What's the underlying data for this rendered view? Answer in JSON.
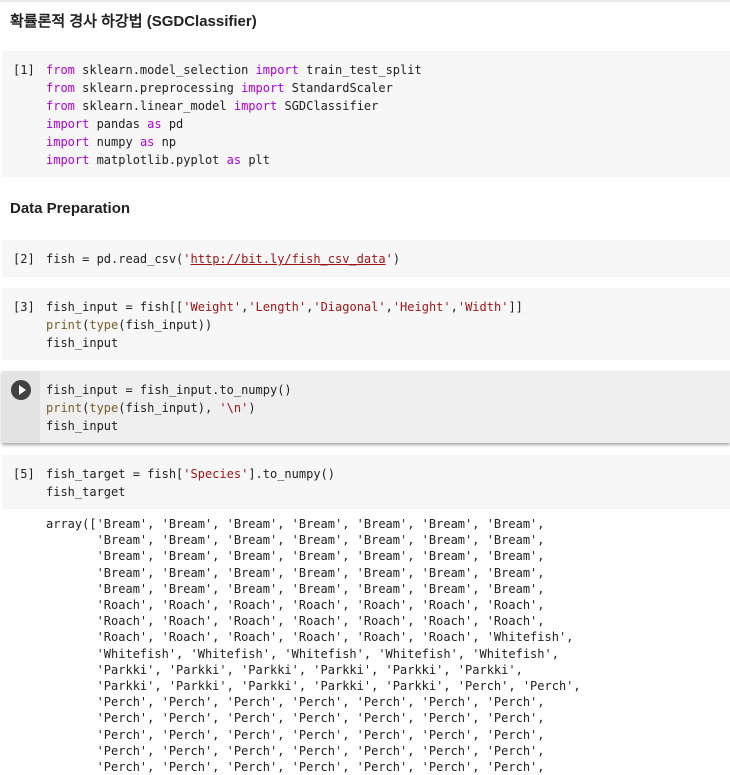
{
  "headings": {
    "title": "확률론적 경사 하강법 (SGDClassifier)",
    "data_prep": "Data Preparation"
  },
  "cells": [
    {
      "prompt": "[1]",
      "lines": [
        [
          {
            "t": "from",
            "c": "kw"
          },
          {
            "t": " sklearn.model_selection "
          },
          {
            "t": "import",
            "c": "kw"
          },
          {
            "t": " train_test_split"
          }
        ],
        [
          {
            "t": "from",
            "c": "kw"
          },
          {
            "t": " sklearn.preprocessing "
          },
          {
            "t": "import",
            "c": "kw"
          },
          {
            "t": " StandardScaler"
          }
        ],
        [
          {
            "t": "from",
            "c": "kw"
          },
          {
            "t": " sklearn.linear_model "
          },
          {
            "t": "import",
            "c": "kw"
          },
          {
            "t": " SGDClassifier"
          }
        ],
        [
          {
            "t": "import",
            "c": "kw"
          },
          {
            "t": " pandas "
          },
          {
            "t": "as",
            "c": "kw"
          },
          {
            "t": " pd"
          }
        ],
        [
          {
            "t": "import",
            "c": "kw"
          },
          {
            "t": " numpy "
          },
          {
            "t": "as",
            "c": "kw"
          },
          {
            "t": " np"
          }
        ],
        [
          {
            "t": "import",
            "c": "kw"
          },
          {
            "t": " matplotlib.pyplot "
          },
          {
            "t": "as",
            "c": "kw"
          },
          {
            "t": " plt"
          }
        ]
      ]
    },
    {
      "prompt": "[2]",
      "lines": [
        [
          {
            "t": "fish = pd.read_csv("
          },
          {
            "t": "'",
            "c": "str"
          },
          {
            "t": "http://bit.ly/fish_csv_data",
            "c": "link"
          },
          {
            "t": "'",
            "c": "str"
          },
          {
            "t": ")"
          }
        ]
      ]
    },
    {
      "prompt": "[3]",
      "lines": [
        [
          {
            "t": "fish_input = fish[["
          },
          {
            "t": "'Weight'",
            "c": "str"
          },
          {
            "t": ","
          },
          {
            "t": "'Length'",
            "c": "str"
          },
          {
            "t": ","
          },
          {
            "t": "'Diagonal'",
            "c": "str"
          },
          {
            "t": ","
          },
          {
            "t": "'Height'",
            "c": "str"
          },
          {
            "t": ","
          },
          {
            "t": "'Width'",
            "c": "str"
          },
          {
            "t": "]]"
          }
        ],
        [
          {
            "t": "print",
            "c": "fn"
          },
          {
            "t": "("
          },
          {
            "t": "type",
            "c": "fn"
          },
          {
            "t": "(fish_input))"
          }
        ],
        [
          {
            "t": "fish_input"
          }
        ]
      ]
    },
    {
      "prompt": "",
      "lines": [
        [
          {
            "t": "fish_input = fish_input.to_numpy()"
          }
        ],
        [
          {
            "t": "print",
            "c": "fn"
          },
          {
            "t": "("
          },
          {
            "t": "type",
            "c": "fn"
          },
          {
            "t": "(fish_input), "
          },
          {
            "t": "'\\n'",
            "c": "str"
          },
          {
            "t": ")"
          }
        ],
        [
          {
            "t": "fish_input"
          }
        ]
      ]
    },
    {
      "prompt": "[5]",
      "lines": [
        [
          {
            "t": "fish_target = fish["
          },
          {
            "t": "'Species'",
            "c": "str"
          },
          {
            "t": "].to_numpy()"
          }
        ],
        [
          {
            "t": "fish_target"
          }
        ]
      ]
    }
  ],
  "output_lines": [
    "array(['Bream', 'Bream', 'Bream', 'Bream', 'Bream', 'Bream', 'Bream',",
    "       'Bream', 'Bream', 'Bream', 'Bream', 'Bream', 'Bream', 'Bream',",
    "       'Bream', 'Bream', 'Bream', 'Bream', 'Bream', 'Bream', 'Bream',",
    "       'Bream', 'Bream', 'Bream', 'Bream', 'Bream', 'Bream', 'Bream',",
    "       'Bream', 'Bream', 'Bream', 'Bream', 'Bream', 'Bream', 'Bream',",
    "       'Roach', 'Roach', 'Roach', 'Roach', 'Roach', 'Roach', 'Roach',",
    "       'Roach', 'Roach', 'Roach', 'Roach', 'Roach', 'Roach', 'Roach',",
    "       'Roach', 'Roach', 'Roach', 'Roach', 'Roach', 'Roach', 'Whitefish',",
    "       'Whitefish', 'Whitefish', 'Whitefish', 'Whitefish', 'Whitefish',",
    "       'Parkki', 'Parkki', 'Parkki', 'Parkki', 'Parkki', 'Parkki',",
    "       'Parkki', 'Parkki', 'Parkki', 'Parkki', 'Parkki', 'Perch', 'Perch',",
    "       'Perch', 'Perch', 'Perch', 'Perch', 'Perch', 'Perch', 'Perch',",
    "       'Perch', 'Perch', 'Perch', 'Perch', 'Perch', 'Perch', 'Perch',",
    "       'Perch', 'Perch', 'Perch', 'Perch', 'Perch', 'Perch', 'Perch',",
    "       'Perch', 'Perch', 'Perch', 'Perch', 'Perch', 'Perch', 'Perch',",
    "       'Perch', 'Perch', 'Perch', 'Perch', 'Perch', 'Perch', 'Perch',"
  ],
  "icons": {
    "run": "play-circle-icon"
  }
}
